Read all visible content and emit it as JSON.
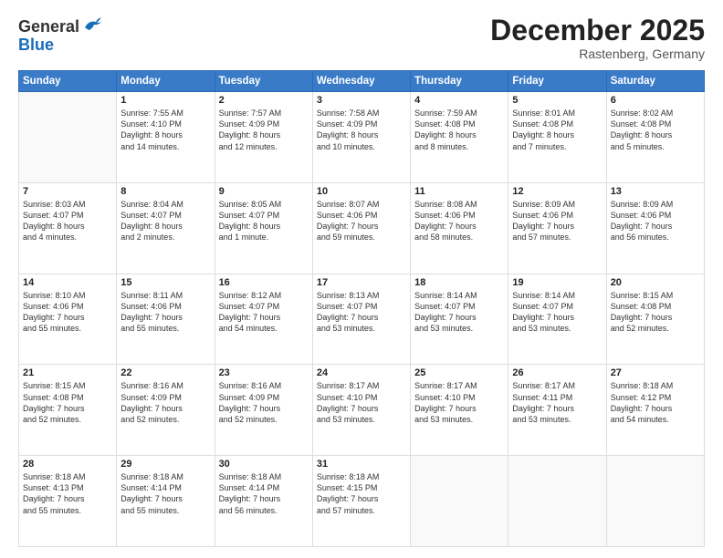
{
  "header": {
    "logo": {
      "line1": "General",
      "line2": "Blue"
    },
    "title": "December 2025",
    "subtitle": "Rastenberg, Germany"
  },
  "days_of_week": [
    "Sunday",
    "Monday",
    "Tuesday",
    "Wednesday",
    "Thursday",
    "Friday",
    "Saturday"
  ],
  "weeks": [
    [
      {
        "day": "",
        "info": ""
      },
      {
        "day": "1",
        "info": "Sunrise: 7:55 AM\nSunset: 4:10 PM\nDaylight: 8 hours\nand 14 minutes."
      },
      {
        "day": "2",
        "info": "Sunrise: 7:57 AM\nSunset: 4:09 PM\nDaylight: 8 hours\nand 12 minutes."
      },
      {
        "day": "3",
        "info": "Sunrise: 7:58 AM\nSunset: 4:09 PM\nDaylight: 8 hours\nand 10 minutes."
      },
      {
        "day": "4",
        "info": "Sunrise: 7:59 AM\nSunset: 4:08 PM\nDaylight: 8 hours\nand 8 minutes."
      },
      {
        "day": "5",
        "info": "Sunrise: 8:01 AM\nSunset: 4:08 PM\nDaylight: 8 hours\nand 7 minutes."
      },
      {
        "day": "6",
        "info": "Sunrise: 8:02 AM\nSunset: 4:08 PM\nDaylight: 8 hours\nand 5 minutes."
      }
    ],
    [
      {
        "day": "7",
        "info": "Sunrise: 8:03 AM\nSunset: 4:07 PM\nDaylight: 8 hours\nand 4 minutes."
      },
      {
        "day": "8",
        "info": "Sunrise: 8:04 AM\nSunset: 4:07 PM\nDaylight: 8 hours\nand 2 minutes."
      },
      {
        "day": "9",
        "info": "Sunrise: 8:05 AM\nSunset: 4:07 PM\nDaylight: 8 hours\nand 1 minute."
      },
      {
        "day": "10",
        "info": "Sunrise: 8:07 AM\nSunset: 4:06 PM\nDaylight: 7 hours\nand 59 minutes."
      },
      {
        "day": "11",
        "info": "Sunrise: 8:08 AM\nSunset: 4:06 PM\nDaylight: 7 hours\nand 58 minutes."
      },
      {
        "day": "12",
        "info": "Sunrise: 8:09 AM\nSunset: 4:06 PM\nDaylight: 7 hours\nand 57 minutes."
      },
      {
        "day": "13",
        "info": "Sunrise: 8:09 AM\nSunset: 4:06 PM\nDaylight: 7 hours\nand 56 minutes."
      }
    ],
    [
      {
        "day": "14",
        "info": "Sunrise: 8:10 AM\nSunset: 4:06 PM\nDaylight: 7 hours\nand 55 minutes."
      },
      {
        "day": "15",
        "info": "Sunrise: 8:11 AM\nSunset: 4:06 PM\nDaylight: 7 hours\nand 55 minutes."
      },
      {
        "day": "16",
        "info": "Sunrise: 8:12 AM\nSunset: 4:07 PM\nDaylight: 7 hours\nand 54 minutes."
      },
      {
        "day": "17",
        "info": "Sunrise: 8:13 AM\nSunset: 4:07 PM\nDaylight: 7 hours\nand 53 minutes."
      },
      {
        "day": "18",
        "info": "Sunrise: 8:14 AM\nSunset: 4:07 PM\nDaylight: 7 hours\nand 53 minutes."
      },
      {
        "day": "19",
        "info": "Sunrise: 8:14 AM\nSunset: 4:07 PM\nDaylight: 7 hours\nand 53 minutes."
      },
      {
        "day": "20",
        "info": "Sunrise: 8:15 AM\nSunset: 4:08 PM\nDaylight: 7 hours\nand 52 minutes."
      }
    ],
    [
      {
        "day": "21",
        "info": "Sunrise: 8:15 AM\nSunset: 4:08 PM\nDaylight: 7 hours\nand 52 minutes."
      },
      {
        "day": "22",
        "info": "Sunrise: 8:16 AM\nSunset: 4:09 PM\nDaylight: 7 hours\nand 52 minutes."
      },
      {
        "day": "23",
        "info": "Sunrise: 8:16 AM\nSunset: 4:09 PM\nDaylight: 7 hours\nand 52 minutes."
      },
      {
        "day": "24",
        "info": "Sunrise: 8:17 AM\nSunset: 4:10 PM\nDaylight: 7 hours\nand 53 minutes."
      },
      {
        "day": "25",
        "info": "Sunrise: 8:17 AM\nSunset: 4:10 PM\nDaylight: 7 hours\nand 53 minutes."
      },
      {
        "day": "26",
        "info": "Sunrise: 8:17 AM\nSunset: 4:11 PM\nDaylight: 7 hours\nand 53 minutes."
      },
      {
        "day": "27",
        "info": "Sunrise: 8:18 AM\nSunset: 4:12 PM\nDaylight: 7 hours\nand 54 minutes."
      }
    ],
    [
      {
        "day": "28",
        "info": "Sunrise: 8:18 AM\nSunset: 4:13 PM\nDaylight: 7 hours\nand 55 minutes."
      },
      {
        "day": "29",
        "info": "Sunrise: 8:18 AM\nSunset: 4:14 PM\nDaylight: 7 hours\nand 55 minutes."
      },
      {
        "day": "30",
        "info": "Sunrise: 8:18 AM\nSunset: 4:14 PM\nDaylight: 7 hours\nand 56 minutes."
      },
      {
        "day": "31",
        "info": "Sunrise: 8:18 AM\nSunset: 4:15 PM\nDaylight: 7 hours\nand 57 minutes."
      },
      {
        "day": "",
        "info": ""
      },
      {
        "day": "",
        "info": ""
      },
      {
        "day": "",
        "info": ""
      }
    ]
  ]
}
